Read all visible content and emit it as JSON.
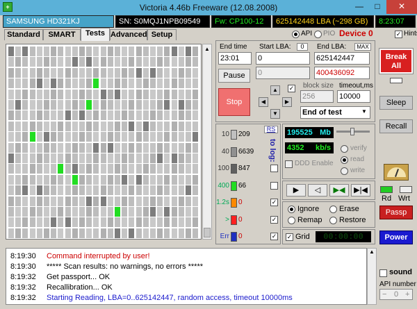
{
  "titlebar": {
    "title": "Victoria 4.46b Freeware (12.08.2008)",
    "min": "—",
    "max": "□",
    "close": "✕"
  },
  "info": {
    "drive": "SAMSUNG HD321KJ",
    "serial": "SN: S0MQJ1NPB09549",
    "firmware": "Fw: CP100-12",
    "capacity": "625142448 LBA (~298 GB)",
    "clock": "8:23:07"
  },
  "tabs": [
    "Standard",
    "SMART",
    "Tests",
    "Advanced",
    "Setup"
  ],
  "mode": {
    "api": "API",
    "pio": "PIO",
    "device": "Device 0",
    "hints": "Hints"
  },
  "controls": {
    "end_time_label": "End time",
    "end_time": "23:01",
    "start_lba_label": "Start LBA:",
    "start_lba_badge": "0",
    "start_lba": "0",
    "end_lba_label": "End LBA:",
    "end_lba_max": "MAX",
    "end_lba": "625142447",
    "current_lba": "0",
    "current_lba_red": "400436092",
    "pause": "Pause",
    "stop": "Stop",
    "block_size_label": "block size",
    "block_size": "256",
    "timeout_label": "timeout,ms",
    "timeout": "10000",
    "end_action": "End of test"
  },
  "stats": {
    "rs": "RS",
    "to_log": "to log:",
    "rows": [
      {
        "label": "10",
        "count": "209",
        "color": "#c0c0c0"
      },
      {
        "label": "40",
        "count": "6639",
        "color": "#909090"
      },
      {
        "label": "100",
        "count": "847",
        "color": "#606060"
      },
      {
        "label": "400",
        "count": "66",
        "color": "#22dd22"
      },
      {
        "label": "1.2s",
        "count": "0",
        "color": "#ff8800"
      },
      {
        "label": ">",
        "count": "0",
        "color": "#ff2020"
      },
      {
        "label": "Err",
        "count": "0",
        "color": "#2030c0"
      }
    ]
  },
  "speed": {
    "mb": "195525",
    "mb_unit": "Mb",
    "kbs": "4352",
    "kbs_unit": "kb/s",
    "ddd": "DDD Enable",
    "verify": "verify",
    "read": "read",
    "write": "write"
  },
  "actions": {
    "ignore": "Ignore",
    "erase": "Erase",
    "remap": "Remap",
    "restore": "Restore",
    "grid": "Grid",
    "timer": "00:00:00"
  },
  "right": {
    "break": "Break All",
    "sleep": "Sleep",
    "recall": "Recall",
    "rd": "Rd",
    "wrt": "Wrt",
    "passp": "Passp",
    "power": "Power",
    "sound": "sound",
    "api_number": "API number",
    "api_value": "0"
  },
  "log": [
    {
      "time": "8:19:30",
      "text": "Command interrupted by user!",
      "color": "#cc0000"
    },
    {
      "time": "8:19:30",
      "text": "***** Scan results: no warnings, no errors *****",
      "color": "#000000"
    },
    {
      "time": "8:19:32",
      "text": "Get passport... OK",
      "color": "#000000"
    },
    {
      "time": "8:19:32",
      "text": "Recallibration... OK",
      "color": "#000000"
    },
    {
      "time": "8:19:32",
      "text": "Starting Reading, LBA=0..625142447, random access, timeout 10000ms",
      "color": "#1a1acc"
    }
  ]
}
